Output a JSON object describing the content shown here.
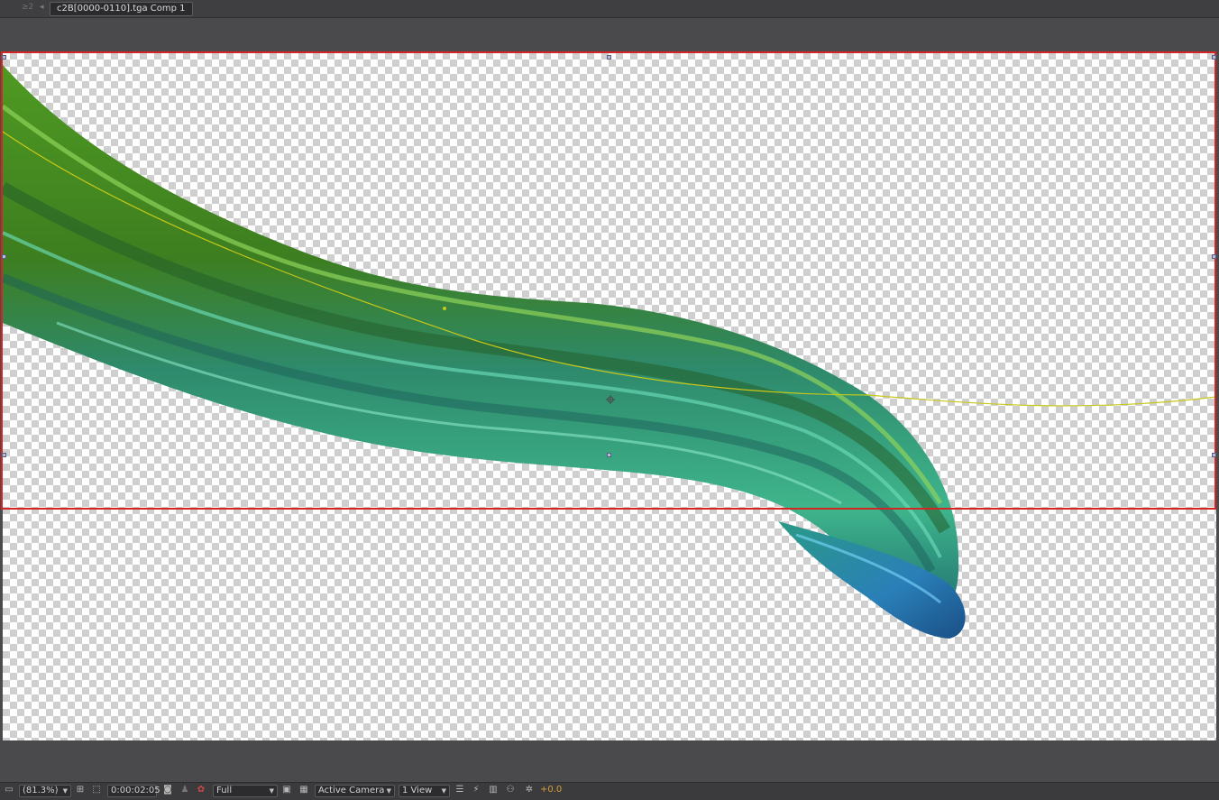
{
  "tabbar": {
    "lock_glyph": "≥2",
    "nav_glyph": "◂",
    "comp_tab_label": "c2B[0000-0110].tga Comp 1"
  },
  "toolbar": {
    "magnification": "(81.3%)",
    "timecode": "0:00:02:05",
    "resolution": "Full",
    "camera": "Active Camera",
    "view_layout": "1 View",
    "exposure": "+0.0"
  },
  "colors": {
    "region_of_interest": "#d42525",
    "motion_path": "#c8c81a",
    "exposure_text": "#d4a13a",
    "ribbon_green": "#5aa828",
    "ribbon_teal": "#2f9e86",
    "ribbon_blue": "#2a7fb8"
  },
  "icons": [
    "monitor-icon",
    "zoom-dropdown-icon",
    "grid-overlay-icon",
    "region-of-interest-icon",
    "snapshot-icon",
    "show-snapshot-icon",
    "color-channels-icon",
    "fast-preview-icon",
    "transparency-grid-icon",
    "view-options-icon",
    "timeline-icon",
    "flowchart-icon",
    "reset-exposure-icon"
  ]
}
